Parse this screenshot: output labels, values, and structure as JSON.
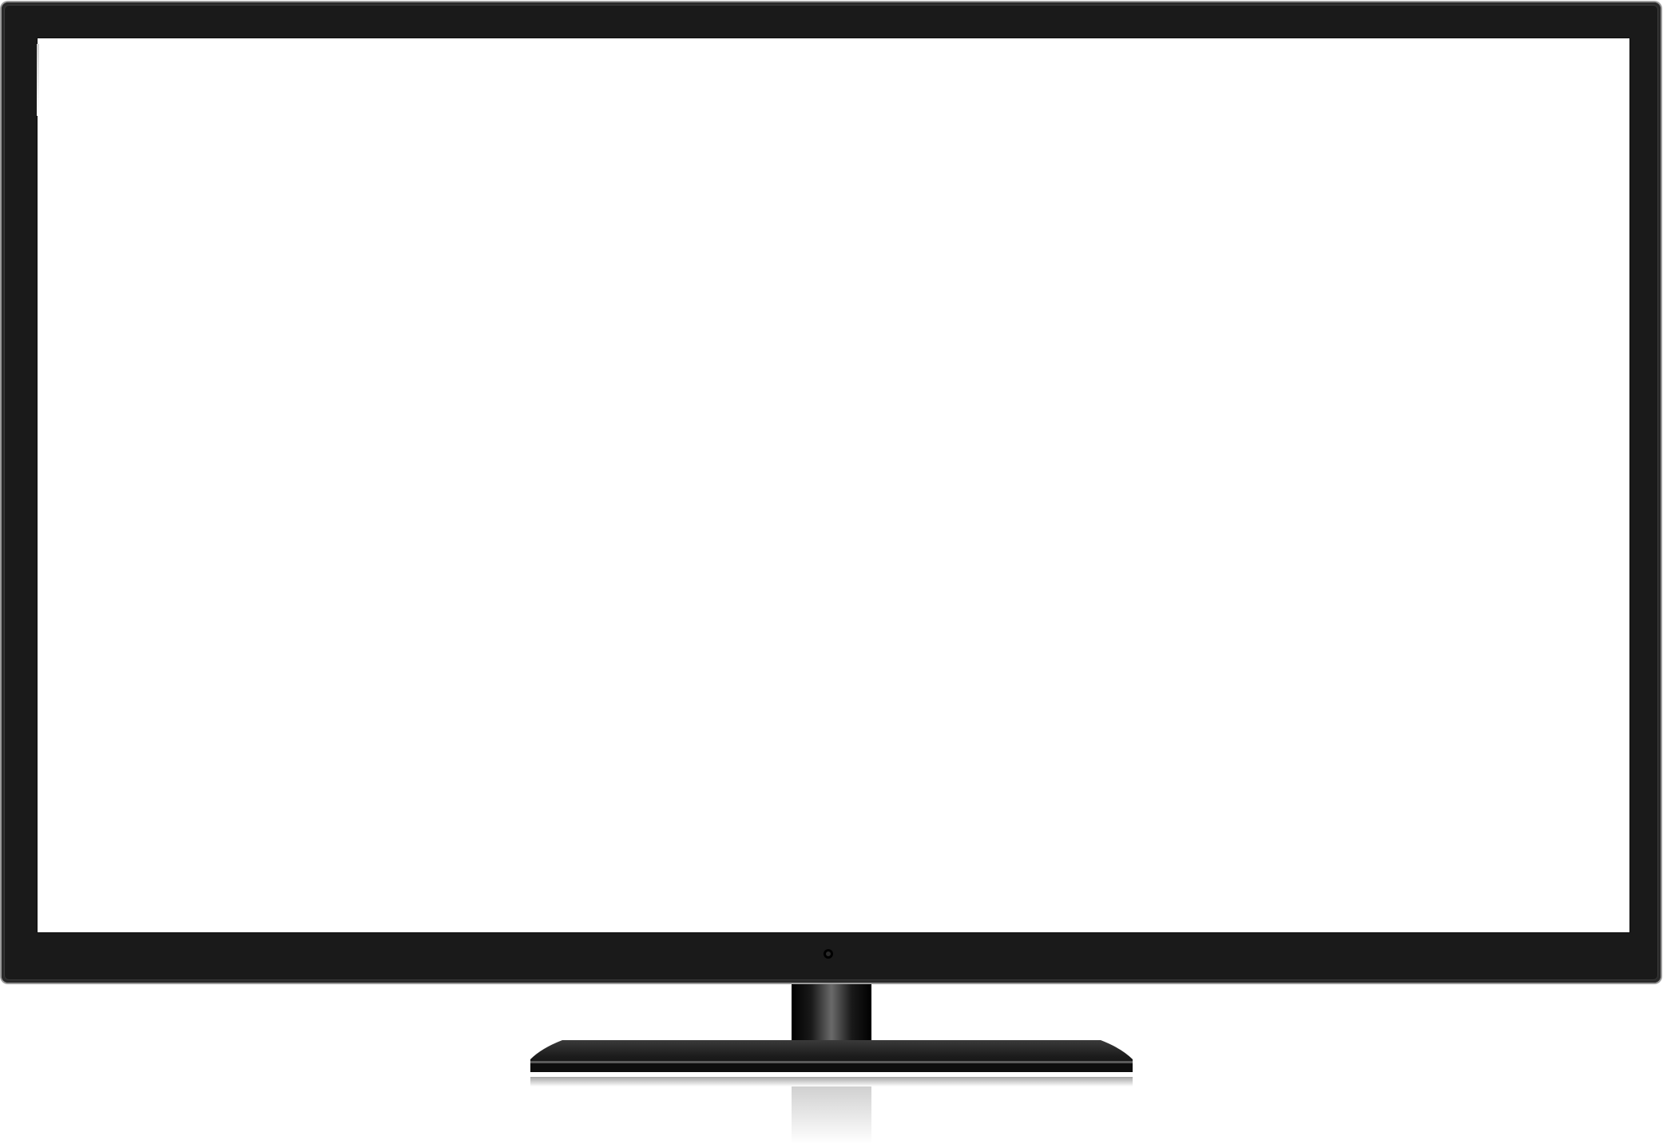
{
  "device": {
    "type": "flat-screen television",
    "screen_content": "",
    "colors": {
      "bezel": "#1a1a1a",
      "bezel_edge": "#9a9a9a",
      "screen": "#ffffff",
      "stand": "#111111"
    },
    "icons": {
      "power": "power-indicator-icon"
    }
  }
}
